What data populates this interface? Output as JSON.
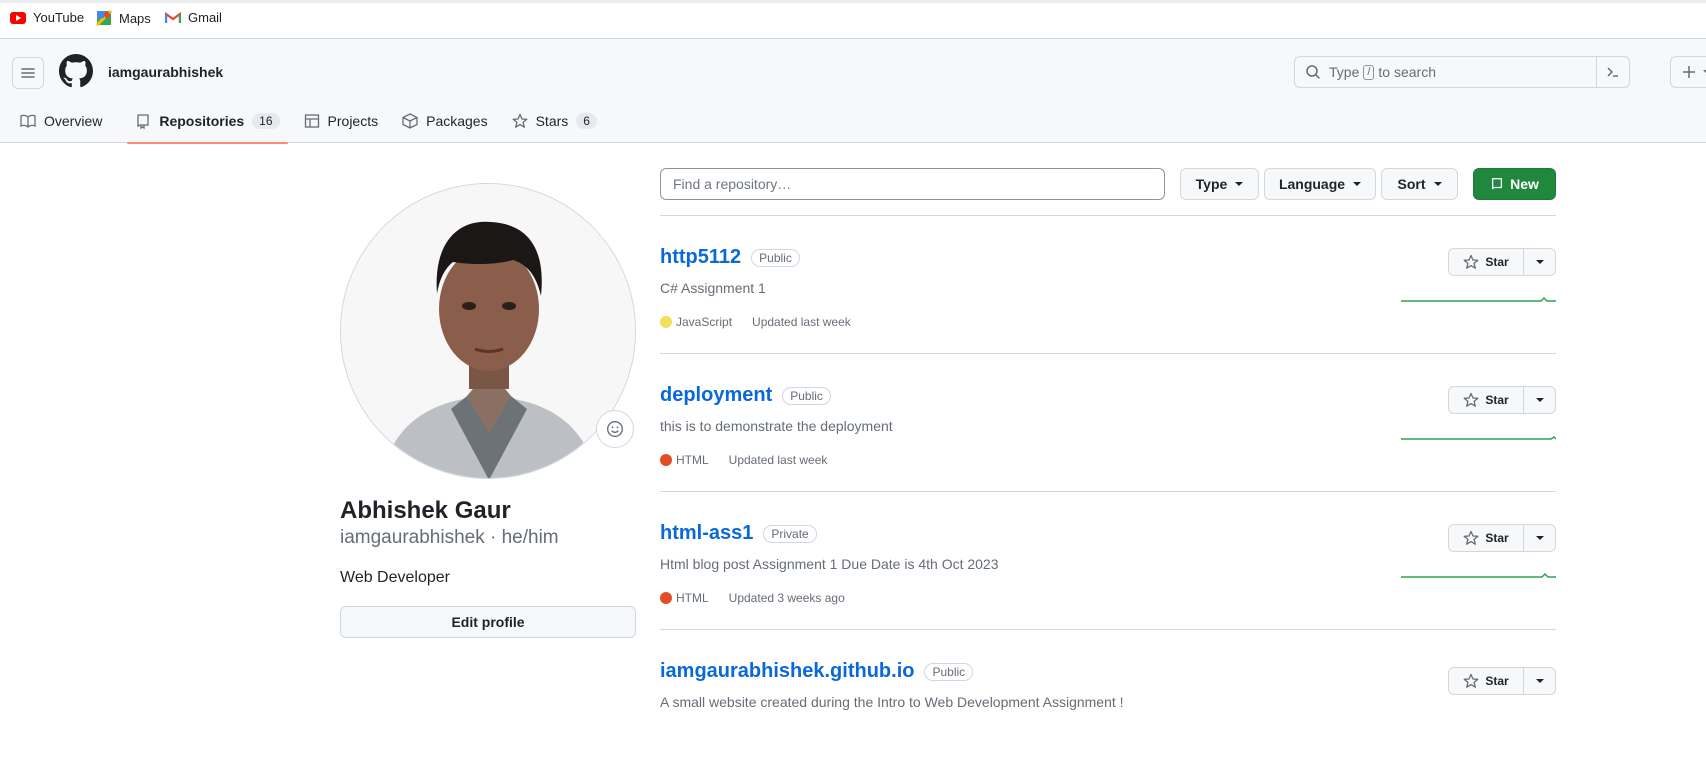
{
  "bookmarks": [
    {
      "label": "YouTube",
      "icon": "youtube-icon"
    },
    {
      "label": "Maps",
      "icon": "maps-icon"
    },
    {
      "label": "Gmail",
      "icon": "gmail-icon"
    }
  ],
  "header": {
    "username": "iamgaurabhishek",
    "search_prefix": "Type",
    "search_key": "/",
    "search_suffix": "to search"
  },
  "tabs": [
    {
      "label": "Overview",
      "icon": "book-icon"
    },
    {
      "label": "Repositories",
      "icon": "repo-icon",
      "count": "16",
      "selected": true
    },
    {
      "label": "Projects",
      "icon": "table-icon"
    },
    {
      "label": "Packages",
      "icon": "package-icon"
    },
    {
      "label": "Stars",
      "icon": "star-icon",
      "count": "6"
    }
  ],
  "profile": {
    "full_name": "Abhishek Gaur",
    "login_line": "iamgaurabhishek · he/him",
    "bio": "Web Developer",
    "edit_label": "Edit profile"
  },
  "toolbar": {
    "find_placeholder": "Find a repository…",
    "type_label": "Type",
    "language_label": "Language",
    "sort_label": "Sort",
    "new_label": "New"
  },
  "repos": [
    {
      "name": "http5112",
      "visibility": "Public",
      "description": "C# Assignment 1",
      "language": "JavaScript",
      "lang_color": "#f1e05a",
      "updated": "Updated last week",
      "star_label": "Star"
    },
    {
      "name": "deployment",
      "visibility": "Public",
      "description": "this is to demonstrate the deployment",
      "language": "HTML",
      "lang_color": "#e34c26",
      "updated": "Updated last week",
      "star_label": "Star"
    },
    {
      "name": "html-ass1",
      "visibility": "Private",
      "description": "Html blog post Assignment 1 Due Date is 4th Oct 2023",
      "language": "HTML",
      "lang_color": "#e34c26",
      "updated": "Updated 3 weeks ago",
      "star_label": "Star"
    },
    {
      "name": "iamgaurabhishek.github.io",
      "visibility": "Public",
      "description": "A small website created during the Intro to Web Development Assignment !",
      "language": "",
      "lang_color": "",
      "updated": "",
      "star_label": "Star"
    }
  ],
  "colors": {
    "accent": "#0969da",
    "new_button": "#1f883d",
    "tab_underline": "#fd8c73",
    "sparkline": "#2da44e"
  }
}
